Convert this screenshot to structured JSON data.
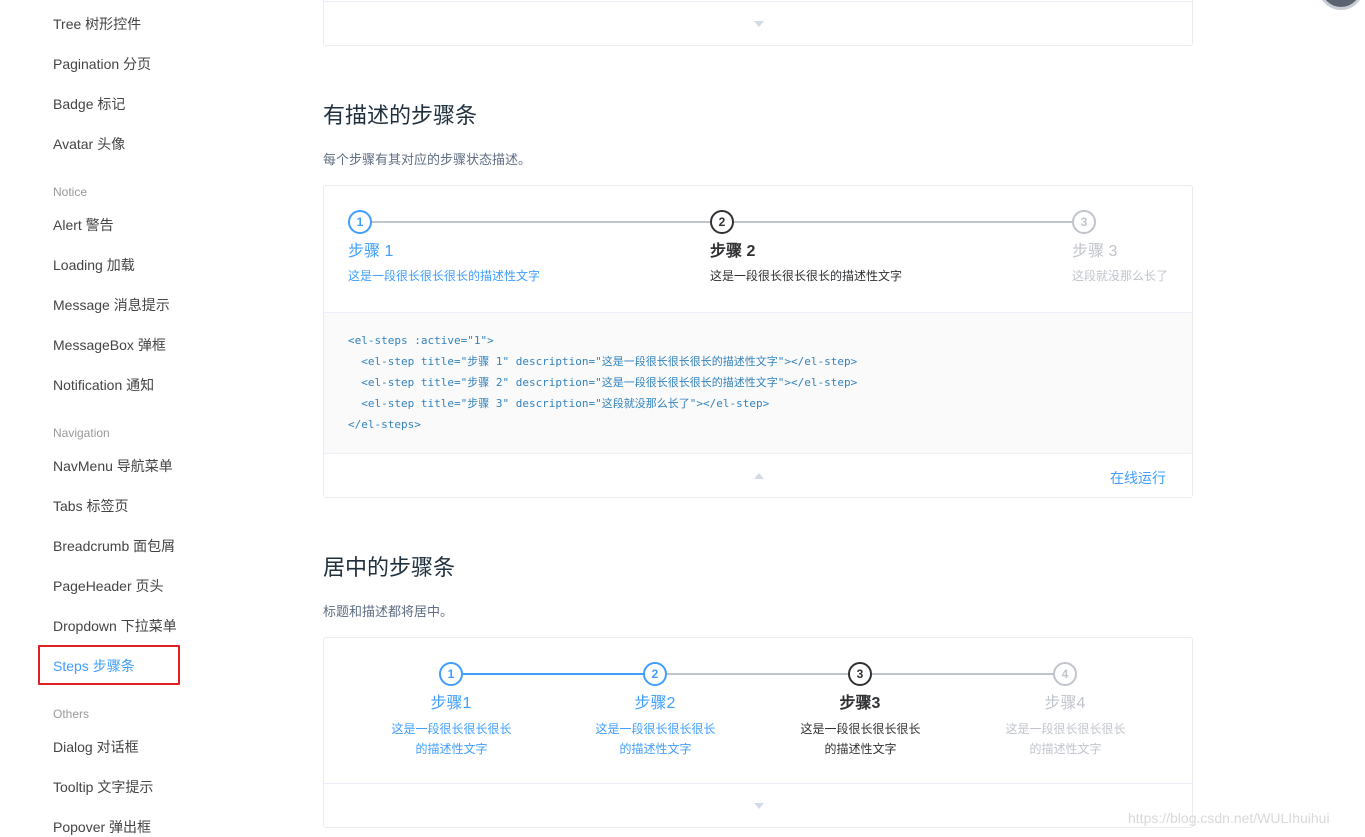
{
  "sidebar": {
    "items": [
      {
        "label": "Tree 树形控件"
      },
      {
        "label": "Pagination 分页"
      },
      {
        "label": "Badge 标记"
      },
      {
        "label": "Avatar 头像"
      },
      {
        "group": "Notice"
      },
      {
        "label": "Alert 警告"
      },
      {
        "label": "Loading 加载"
      },
      {
        "label": "Message 消息提示"
      },
      {
        "label": "MessageBox 弹框"
      },
      {
        "label": "Notification 通知"
      },
      {
        "group": "Navigation"
      },
      {
        "label": "NavMenu 导航菜单"
      },
      {
        "label": "Tabs 标签页"
      },
      {
        "label": "Breadcrumb 面包屑"
      },
      {
        "label": "PageHeader 页头"
      },
      {
        "label": "Dropdown 下拉菜单"
      },
      {
        "label": "Steps 步骤条"
      },
      {
        "group": "Others"
      },
      {
        "label": "Dialog 对话框"
      },
      {
        "label": "Tooltip 文字提示"
      },
      {
        "label": "Popover 弹出框"
      }
    ],
    "active_label": "Steps 步骤条"
  },
  "section_desc": {
    "title": "有描述的步骤条",
    "description": "每个步骤有其对应的步骤状态描述。",
    "steps": [
      {
        "title": "步骤 1",
        "number": "1",
        "desc": "这是一段很长很长很长的描述性文字",
        "status": "finish"
      },
      {
        "title": "步骤 2",
        "number": "2",
        "desc": "这是一段很长很长很长的描述性文字",
        "status": "process"
      },
      {
        "title": "步骤 3",
        "number": "3",
        "desc": "这段就没那么长了",
        "status": "wait"
      }
    ],
    "code": [
      "<el-steps :active=\"1\">",
      "  <el-step title=\"步骤 1\" description=\"这是一段很长很长很长的描述性文字\"></el-step>",
      "  <el-step title=\"步骤 2\" description=\"这是一段很长很长很长的描述性文字\"></el-step>",
      "  <el-step title=\"步骤 3\" description=\"这段就没那么长了\"></el-step>",
      "</el-steps>"
    ],
    "run_online": "在线运行"
  },
  "section_center": {
    "title": "居中的步骤条",
    "description": "标题和描述都将居中。",
    "steps": [
      {
        "title": "步骤1",
        "number": "1",
        "desc": "这是一段很长很长很长的描述性文字",
        "status": "finish"
      },
      {
        "title": "步骤2",
        "number": "2",
        "desc": "这是一段很长很长很长的描述性文字",
        "status": "finish"
      },
      {
        "title": "步骤3",
        "number": "3",
        "desc": "这是一段很长很长很长的描述性文字",
        "status": "process"
      },
      {
        "title": "步骤4",
        "number": "4",
        "desc": "这是一段很长很长很长的描述性文字",
        "status": "wait"
      }
    ]
  },
  "watermark": "https://blog.csdn.net/WULIhuihui",
  "colors": {
    "accent": "#409eff",
    "process": "#303133",
    "wait": "#c0c4cc",
    "highlight_box": "#e02020"
  }
}
